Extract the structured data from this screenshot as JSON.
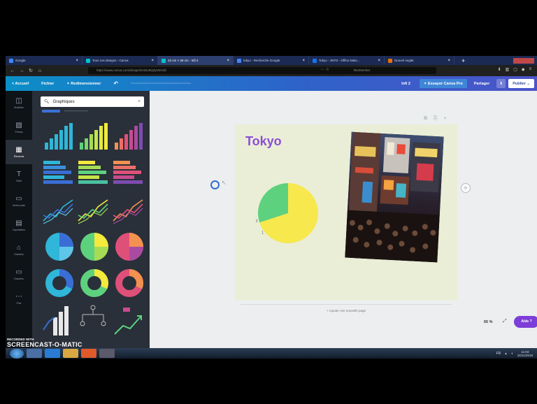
{
  "browser": {
    "tabs": [
      {
        "label": "Google",
        "color": "#4285f4",
        "active": false
      },
      {
        "label": "Tous vos designs - Canva",
        "color": "#00c4cc",
        "active": false
      },
      {
        "label": "22 cm × 28 cm - Infi 2",
        "color": "#00c4cc",
        "active": true
      },
      {
        "label": "tokyo - Recherche Google",
        "color": "#4285f4",
        "active": false
      },
      {
        "label": "Tokyo - JNTO - Office Natio...",
        "color": "#1a73e8",
        "active": false
      },
      {
        "label": "Nouvel onglet",
        "color": "#e8710a",
        "active": false
      }
    ],
    "url": "https://www.canva.com/design/DADtx9QdyD0/edit",
    "search_placeholder": "Rechercher"
  },
  "canva_bar": {
    "home": "< Accueil",
    "file": "Fichier",
    "resize": "✦ Redimensionner",
    "design_name": "Infi 2",
    "try_pro": "✦ Essayer Canva Pro",
    "share": "Partager",
    "publish": "Publier ⌄"
  },
  "rail": [
    {
      "icon": "◫",
      "label": "Modèles",
      "name": "templates-icon"
    },
    {
      "icon": "▧",
      "label": "Photos",
      "name": "photos-icon"
    },
    {
      "icon": "▦",
      "label": "Éléments",
      "name": "elements-icon",
      "active": true
    },
    {
      "icon": "T",
      "label": "Texte",
      "name": "text-icon"
    },
    {
      "icon": "▭",
      "label": "Arrière-plan",
      "name": "background-icon"
    },
    {
      "icon": "▤",
      "label": "Importation",
      "name": "uploads-icon"
    },
    {
      "icon": "⌂",
      "label": "Dossiers",
      "name": "folders-icon"
    },
    {
      "icon": "▭",
      "label": "Dossiers",
      "name": "folders2-icon"
    },
    {
      "icon": "⋯",
      "label": "Plus",
      "name": "more-icon"
    }
  ],
  "panel": {
    "search_value": "Graphiques"
  },
  "canvas": {
    "title": "Tokyo",
    "add_page": "+ Ajouter une nouvelle page",
    "zoom": "65 %",
    "help": "Aide ?"
  },
  "chart_data": {
    "type": "pie",
    "categories": [
      "1",
      "2"
    ],
    "values": [
      70,
      30
    ],
    "colors": [
      "#f7e84e",
      "#5ed17e"
    ]
  },
  "taskbar": {
    "clock_time": "11:03",
    "clock_date": "16/11/2019"
  },
  "watermark": {
    "line1": "RECORDED WITH",
    "line2": "SCREENCAST-O-MATIC"
  }
}
